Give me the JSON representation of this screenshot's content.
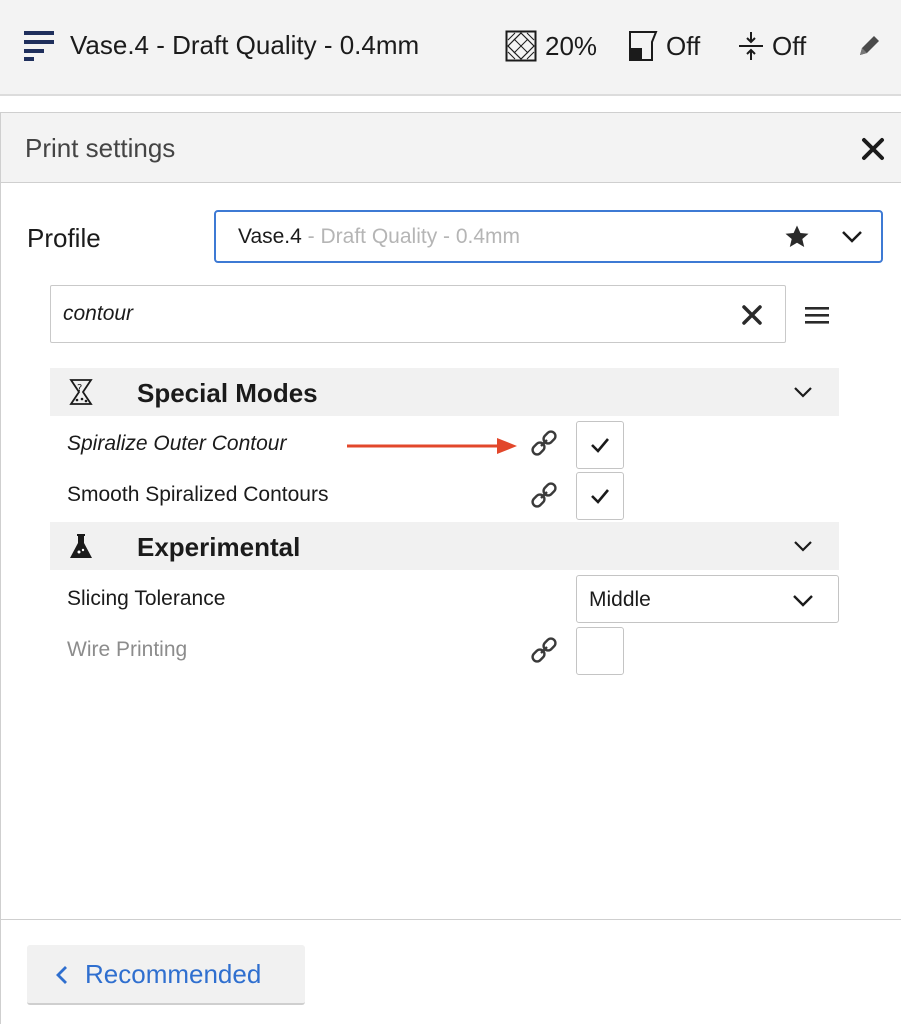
{
  "header": {
    "title": "Vase.4 - Draft Quality - 0.4mm",
    "infill_value": "20%",
    "support_value": "Off",
    "adhesion_value": "Off"
  },
  "panel": {
    "title": "Print settings",
    "profile_label": "Profile",
    "profile_name": "Vase.4",
    "profile_sub": " - Draft Quality - 0.4mm"
  },
  "search": {
    "value": "contour"
  },
  "categories": [
    {
      "label": "Special Modes",
      "settings": [
        {
          "label": "Spiralize Outer Contour",
          "checked": true
        },
        {
          "label": "Smooth Spiralized Contours",
          "checked": true
        }
      ]
    },
    {
      "label": "Experimental",
      "settings": [
        {
          "label": "Slicing Tolerance",
          "value": "Middle"
        },
        {
          "label": "Wire Printing",
          "checked": false
        }
      ]
    }
  ],
  "footer": {
    "recommended_label": "Recommended"
  },
  "colors": {
    "accent": "#2f6fcf",
    "annotation_arrow": "#e2472b"
  },
  "icons": {
    "profile": "print-profile-icon",
    "infill": "infill-icon",
    "support": "support-icon",
    "adhesion": "adhesion-icon",
    "edit": "pencil-icon",
    "close": "close-icon",
    "favorite": "star-icon",
    "link": "link-icon",
    "special_modes": "special-modes-icon",
    "experimental": "flask-icon",
    "menu": "menu-icon"
  }
}
